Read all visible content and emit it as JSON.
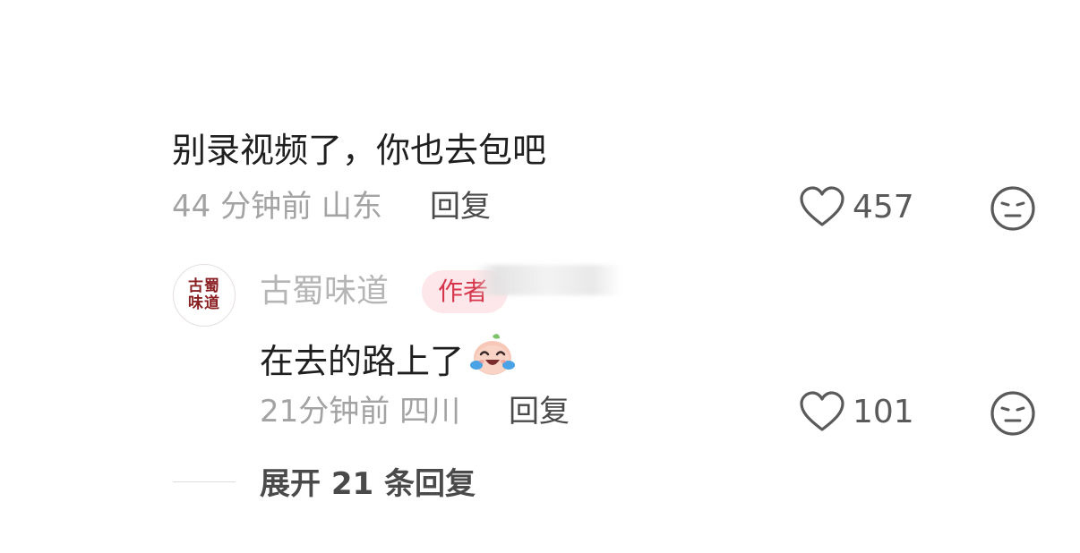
{
  "comment": {
    "text": "别录视频了，你也去包吧",
    "meta": "44 分钟前 山东",
    "reply_label": "回复",
    "like_count": "457"
  },
  "reply": {
    "avatar_text_top": "古蜀",
    "avatar_text_bottom": "味道",
    "author": "古蜀味道",
    "badge": "作者",
    "text": "在去的路上了",
    "emoji": "crying-laughing-emoji",
    "meta": "21分钟前 四川",
    "reply_label": "回复",
    "like_count": "101"
  },
  "expand_label": "展开 21 条回复",
  "colors": {
    "meta": "#a3a3a3",
    "badge_bg": "#fde7ea",
    "badge_text": "#d6364b",
    "avatar_text": "#8a1f22"
  }
}
